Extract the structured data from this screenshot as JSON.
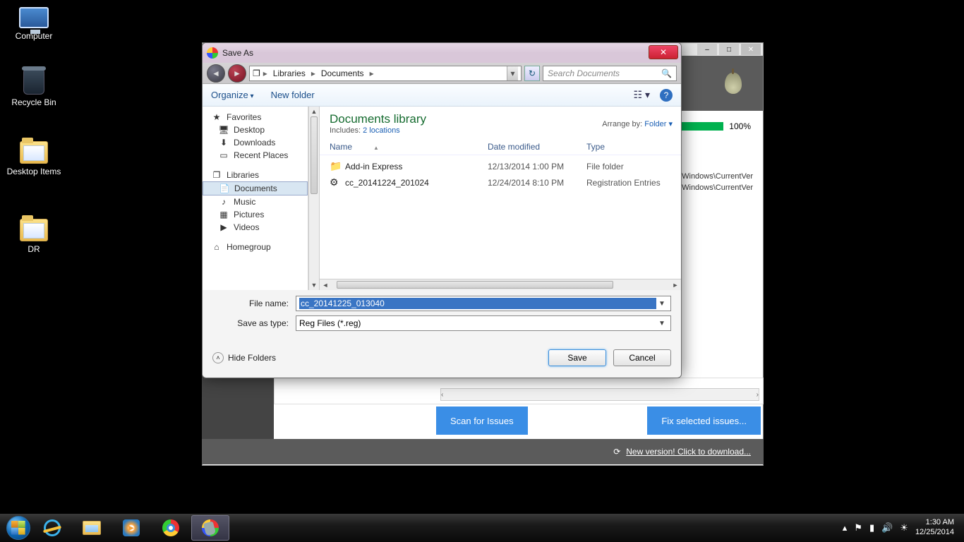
{
  "desktop": {
    "computer": "Computer",
    "recycle": "Recycle Bin",
    "items": "Desktop Items",
    "dr": "DR"
  },
  "bg_app": {
    "progress_pct": "100%",
    "reg_line_1": "t\\Windows\\CurrentVer",
    "reg_line_2": "t\\Windows\\CurrentVer",
    "scan_btn": "Scan for Issues",
    "fix_btn": "Fix selected issues...",
    "footer_link": "New version! Click to download..."
  },
  "dialog": {
    "title": "Save As",
    "breadcrumb": {
      "root_icon": "▸",
      "libs": "Libraries",
      "docs": "Documents"
    },
    "search_placeholder": "Search Documents",
    "toolbar": {
      "organize": "Organize",
      "new_folder": "New folder"
    },
    "library": {
      "title": "Documents library",
      "includes_label": "Includes:",
      "includes_link": "2 locations",
      "arrange_label": "Arrange by:",
      "arrange_value": "Folder"
    },
    "nav": {
      "favorites": "Favorites",
      "desktop": "Desktop",
      "downloads": "Downloads",
      "recent": "Recent Places",
      "libraries": "Libraries",
      "documents": "Documents",
      "music": "Music",
      "pictures": "Pictures",
      "videos": "Videos",
      "homegroup": "Homegroup"
    },
    "columns": {
      "name": "Name",
      "date": "Date modified",
      "type": "Type"
    },
    "rows": [
      {
        "icon": "folder",
        "name": "Add-in Express",
        "date": "12/13/2014 1:00 PM",
        "type": "File folder"
      },
      {
        "icon": "reg",
        "name": "cc_20141224_201024",
        "date": "12/24/2014 8:10 PM",
        "type": "Registration Entries"
      }
    ],
    "form": {
      "filename_label": "File name:",
      "filename_value": "cc_20141225_013040",
      "type_label": "Save as type:",
      "type_value": "Reg Files (*.reg)"
    },
    "footer": {
      "hide": "Hide Folders",
      "save": "Save",
      "cancel": "Cancel"
    }
  },
  "taskbar": {
    "time": "1:30 AM",
    "date": "12/25/2014"
  }
}
